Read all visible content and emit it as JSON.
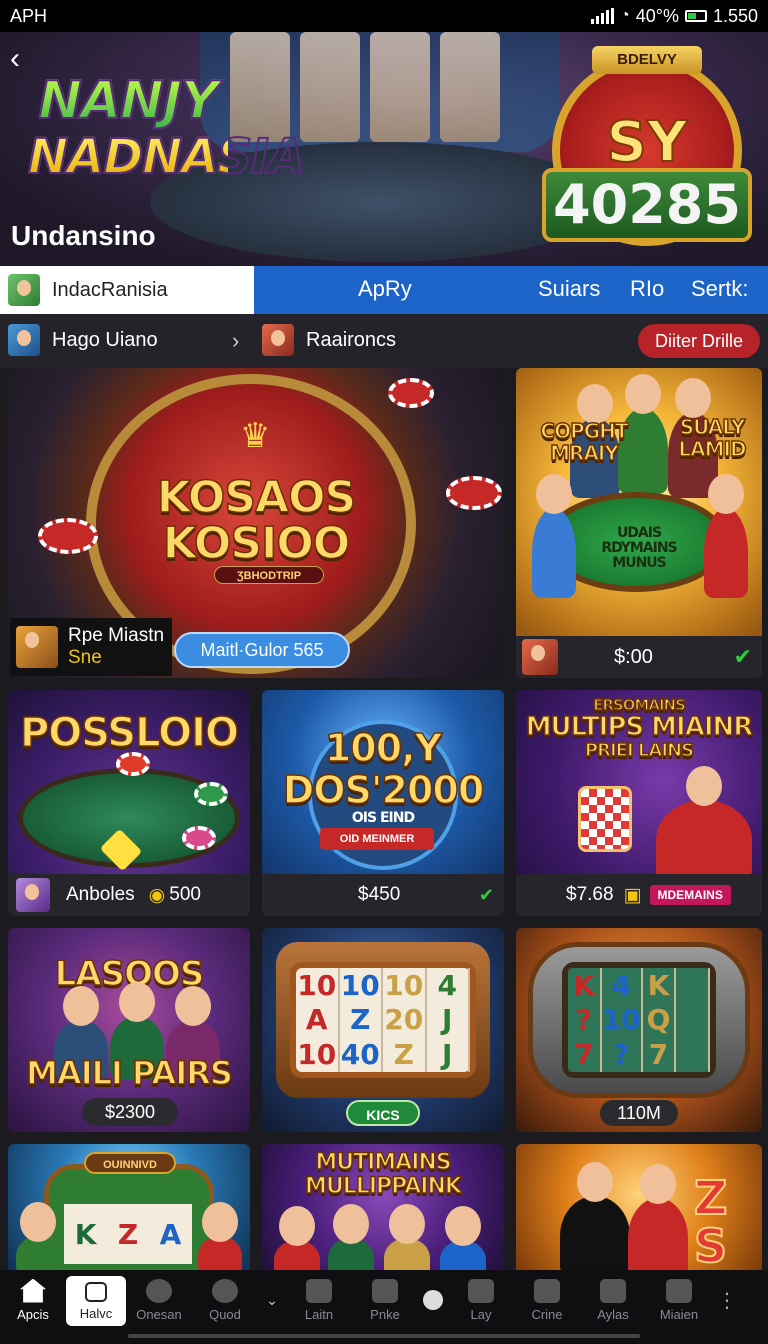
{
  "status_bar": {
    "left": "APH",
    "right": "40°%",
    "time": "1.550"
  },
  "hero": {
    "logo_line1": "NANJY",
    "logo_line2": "NADNASIA",
    "title": "Undansino",
    "badge_top": "BDELVY",
    "badge_mid": "SY",
    "badge_number": "40285"
  },
  "tabs": {
    "user": "IndacRanisia",
    "items": [
      "ApRy",
      "Suiars",
      "RIo",
      "Sertk:"
    ]
  },
  "subbar": {
    "left": "Hago Uiano",
    "mid": "Raaironcs",
    "button": "Diiter Drille"
  },
  "cards": {
    "c1": {
      "title_line1": "KOSAOS",
      "title_line2": "KOSIOO",
      "plate": "ƷBHODTRIP",
      "footer_name": "Rpe Miastn",
      "footer_sub": "Sne",
      "footer_pill": "Maitl·Gulor 565"
    },
    "c2": {
      "left_label": "COPGHT MRAIY",
      "right_label": "SUALY LAMID",
      "table_text": "UDAIS RDYMAINS MUNUS",
      "price": "$:00"
    },
    "c3": {
      "title": "POSSLOIO",
      "name": "Anboles",
      "coin": "500"
    },
    "c4": {
      "title_line1": "100,Y",
      "title_line2": "DOS'2000",
      "sub": "OIS EIND",
      "plate": "OID MEINMER",
      "price": "$450"
    },
    "c5": {
      "top": "ERSOMAINS",
      "title": "MULTIPS MIAINR",
      "sub": "PRIEI LAINS",
      "price": "$7.68",
      "tag": "MDEMAINS"
    },
    "c6": {
      "title_top": "LASOOS",
      "title_bottom": "MAILI PAIRS",
      "price": "$2300"
    },
    "c7": {
      "reels": [
        "10",
        "10",
        "10",
        "4",
        "A",
        "Z",
        "20",
        "J",
        "10",
        "40",
        "Z",
        "J"
      ],
      "plate": "KICS"
    },
    "c8": {
      "reels": [
        "K",
        "4",
        "K",
        "",
        "?",
        "10",
        "Q",
        "",
        "7",
        "?",
        "7",
        ""
      ],
      "price": "110M"
    },
    "c9": {
      "plate": "OUINNIVD",
      "symbols": [
        "K",
        "Z",
        "A"
      ]
    },
    "c10": {
      "title_line1": "MUTIMAINS",
      "title_line2": "MULLIPPAINK"
    },
    "c11": {
      "symbols": "Z S"
    }
  },
  "nav": {
    "items": [
      "Apcis",
      "Halvc",
      "Onesan",
      "Quod",
      "",
      "Laitn",
      "Pnke",
      "",
      "Lay",
      "Crine",
      "Aylas",
      "Miaien"
    ]
  },
  "colors": {
    "accent": "#1c64c8",
    "danger": "#b8232a",
    "pill": "#3a8de0",
    "background": "#1a1a1f"
  }
}
